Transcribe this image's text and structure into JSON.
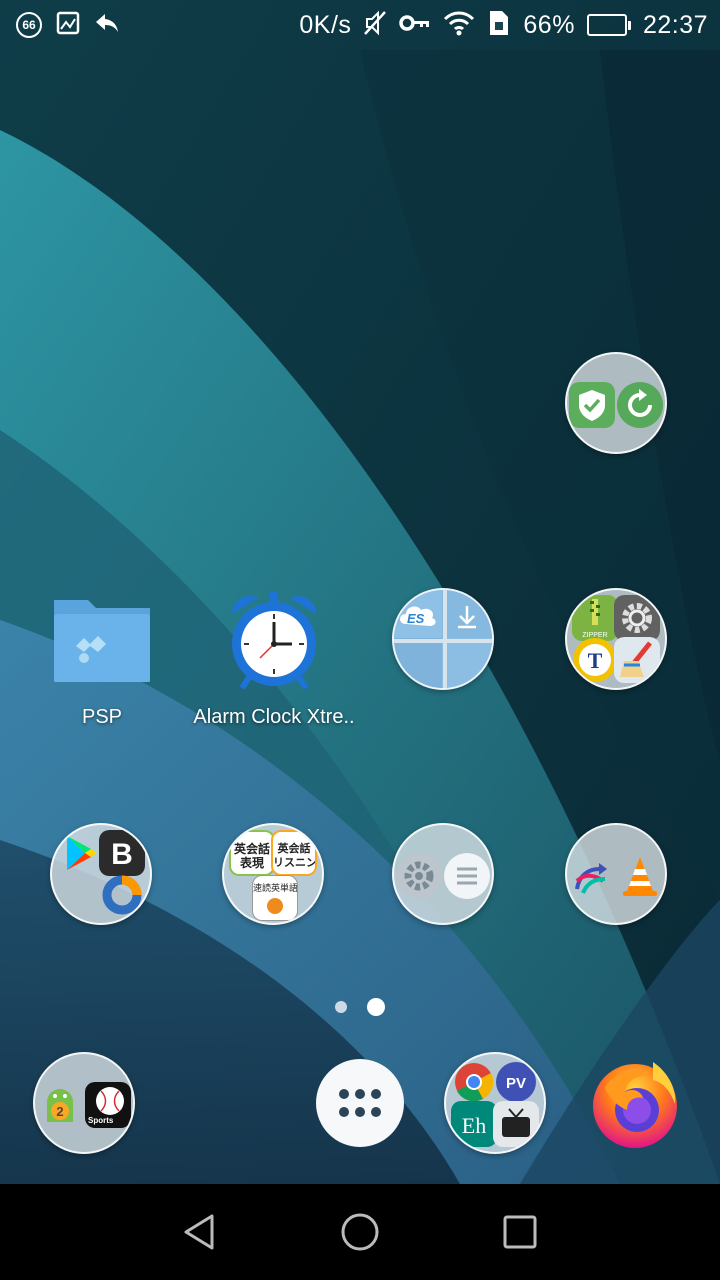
{
  "status_bar": {
    "notification_badge": "66",
    "net_speed": "0K/s",
    "battery_percent_text": "66%",
    "battery_level": 0.66,
    "time": "22:37",
    "icons": [
      "gallery-icon",
      "reply-icon",
      "mute-icon",
      "vpn-key-icon",
      "wifi-icon",
      "sim-icon"
    ]
  },
  "apps": {
    "psp": {
      "label": "PSP",
      "icon": "folder-psp-icon"
    },
    "alarm_clock": {
      "label": "Alarm Clock Xtre..",
      "icon": "alarm-clock-icon"
    }
  },
  "folders": {
    "security_folder": {
      "label": "",
      "icons": [
        "shield-check-icon",
        "refresh-icon"
      ]
    },
    "files_folder": {
      "label": "",
      "icons": [
        "es-file-explorer-icon",
        "download-icon"
      ]
    },
    "tools_folder": {
      "label": "",
      "icons": [
        "zipper-icon",
        "settings-gear-icon",
        "titanium-icon",
        "cleaner-icon"
      ]
    },
    "play_folder": {
      "label": "",
      "icons": [
        "google-play-icon",
        "b-app-icon",
        "donut-chart-icon"
      ]
    },
    "english_folder": {
      "label": "",
      "icons": [
        "english-expression-icon",
        "english-listening-icon",
        "speed-reading-icon"
      ],
      "texts": [
        "英会話",
        "表現",
        "英会話",
        "リスニン",
        "速読英単語"
      ]
    },
    "settings_folder": {
      "label": "",
      "icons": [
        "settings-icon",
        "menu-lines-icon"
      ]
    },
    "media_folder": {
      "label": "",
      "icons": [
        "share-arrows-icon",
        "vlc-cone-icon"
      ]
    }
  },
  "dock": {
    "games_folder": {
      "icons": [
        "android-badge-icon",
        "sports-baseball-icon"
      ],
      "text": "Sports"
    },
    "app_drawer": {
      "icon": "app-drawer-icon"
    },
    "web_folder": {
      "icons": [
        "chrome-icon",
        "pv-icon",
        "eh-icon",
        "tv-icon"
      ],
      "texts": [
        "PV",
        "Eh"
      ]
    },
    "firefox": {
      "icon": "firefox-icon"
    }
  },
  "page_indicator": {
    "pages": 2,
    "current": 2
  },
  "nav_bar": {
    "buttons": [
      "back-icon",
      "home-icon",
      "recents-icon"
    ]
  },
  "colors": {
    "wallpaper_dark": "#0b2e38",
    "wallpaper_teal": "#2a8a9a",
    "wallpaper_blue": "#3f7aa8",
    "folder_bg": "#dce4e8",
    "nav_bg": "#000000"
  }
}
